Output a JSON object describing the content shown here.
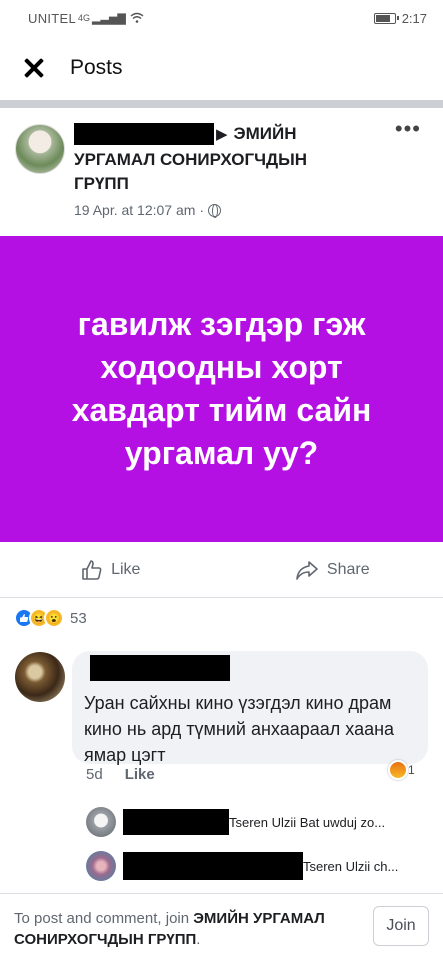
{
  "status_bar": {
    "carrier": "UNITEL",
    "network": "4G",
    "time": "2:17"
  },
  "header": {
    "title": "Posts"
  },
  "post": {
    "group_name": "ЭМИЙН УРГАМАЛ СОНИРХОГЧДЫН ГРҮПП",
    "group_line1": "ЭМИЙН",
    "group_line_rest": "УРГАМАЛ СОНИРХОГЧДЫН ГРҮПП",
    "date": "19 Apr. at 12:07 am",
    "separator": "·",
    "image_text": "гавилж зэгдэр гэж ходоодны хорт хавдарт тийм сайн ургамал уу?",
    "image_bg": "#b40fe3"
  },
  "actions": {
    "like_label": "Like",
    "share_label": "Share"
  },
  "reactions": {
    "count": "53"
  },
  "comment": {
    "text": "Уран сайхны кино үзэгдэл кино драм кино нь ард түмний анхаараал хаана ямар цэгт",
    "age": "5d",
    "like_label": "Like",
    "angry_count": "1"
  },
  "replies": [
    {
      "text": "Tseren Ulzii Bat uwduj zo..."
    },
    {
      "text": "Tseren Ulzii  ch..."
    }
  ],
  "footer": {
    "prefix": "To post and comment, join ",
    "group_name": "ЭМИЙН УРГАМАЛ СОНИРХОГЧДЫН ГРҮПП",
    "suffix": ".",
    "join_label": "Join"
  }
}
